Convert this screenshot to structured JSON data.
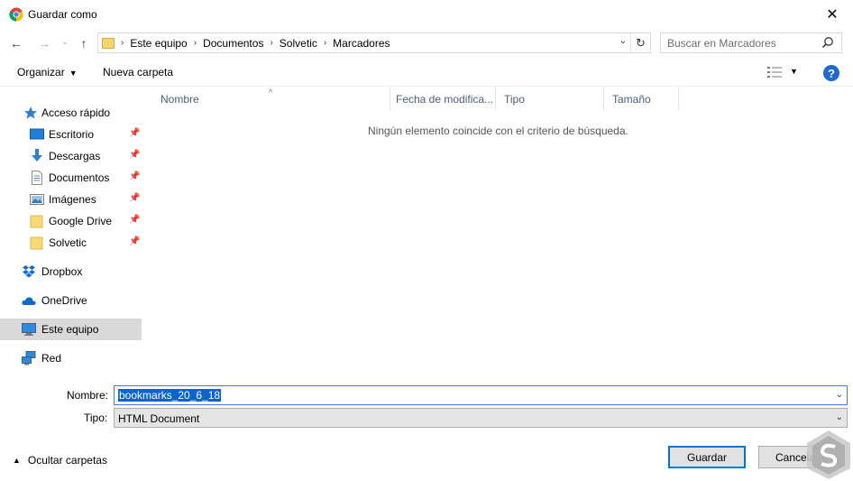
{
  "window": {
    "title": "Guardar como",
    "close_glyph": "✕"
  },
  "nav": {
    "back_glyph": "←",
    "forward_glyph": "→",
    "recent_glyph": "⌄",
    "up_glyph": "↑",
    "breadcrumbs": [
      "Este equipo",
      "Documentos",
      "Solvetic",
      "Marcadores"
    ],
    "separator": "›",
    "dropdown_glyph": "⌄",
    "refresh_glyph": "↻"
  },
  "search": {
    "placeholder": "Buscar en Marcadores"
  },
  "toolbar": {
    "organize_label": "Organizar",
    "organize_caret": "▼",
    "new_folder_label": "Nueva carpeta",
    "view_caret": "▼",
    "help_label": "?"
  },
  "sidebar": {
    "items": [
      {
        "label": "Acceso rápido",
        "icon": "star-icon"
      },
      {
        "label": "Escritorio",
        "icon": "desktop-icon",
        "pinned": true
      },
      {
        "label": "Descargas",
        "icon": "download-icon",
        "pinned": true
      },
      {
        "label": "Documentos",
        "icon": "document-icon",
        "pinned": true
      },
      {
        "label": "Imágenes",
        "icon": "pictures-icon",
        "pinned": true
      },
      {
        "label": "Google Drive",
        "icon": "folder-icon",
        "pinned": true
      },
      {
        "label": "Solvetic",
        "icon": "folder-icon",
        "pinned": true
      },
      {
        "label": "Dropbox",
        "icon": "dropbox-icon"
      },
      {
        "label": "OneDrive",
        "icon": "cloud-icon"
      },
      {
        "label": "Este equipo",
        "icon": "computer-icon",
        "selected": true
      },
      {
        "label": "Red",
        "icon": "network-icon"
      }
    ],
    "pin_glyph": "📌"
  },
  "columns": [
    "Nombre",
    "Fecha de modifica...",
    "Tipo",
    "Tamaño"
  ],
  "sort_glyph": "^",
  "content": {
    "empty_message": "Ningún elemento coincide con el criterio de búsqueda."
  },
  "form": {
    "name_label": "Nombre:",
    "name_value": "bookmarks_20_6_18",
    "type_label": "Tipo:",
    "type_value": "HTML Document",
    "dropdown_glyph": "⌄"
  },
  "footer": {
    "hide_folders_label": "Ocultar carpetas",
    "hide_folders_glyph": "▲",
    "save_label": "Guardar",
    "cancel_label": "Cancelar"
  },
  "colors": {
    "accent": "#0078d7",
    "selection": "#0a64d2",
    "help": "#1e69d2",
    "folder": "#f4d46b"
  }
}
